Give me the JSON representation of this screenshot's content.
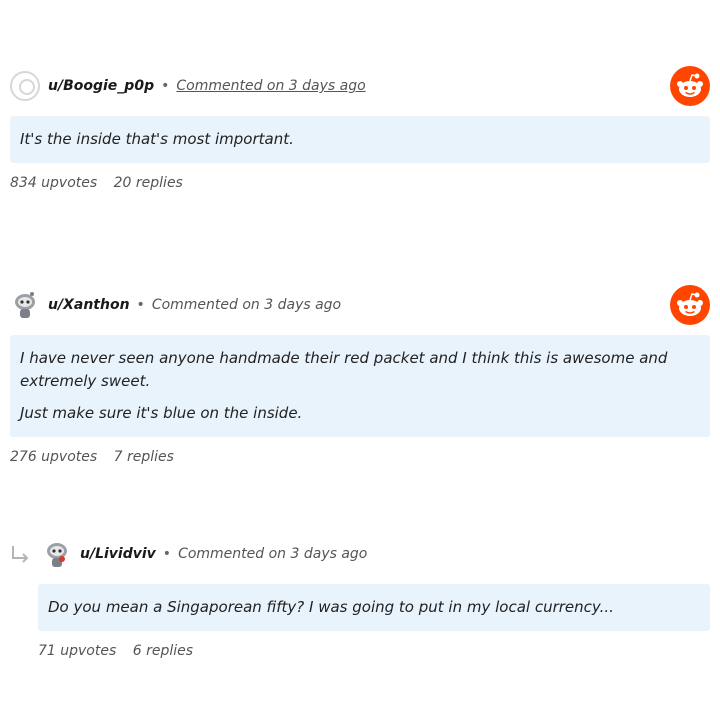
{
  "comments": [
    {
      "author": "u/Boogie_p0p",
      "meta": "Commented on 3 days ago",
      "body": [
        "It's the inside that's most important."
      ],
      "upvotes": "834 upvotes",
      "replies": "20 replies",
      "avatar_icon": "outline-avatar-icon"
    },
    {
      "author": "u/Xanthon",
      "meta": "Commented on 3 days ago",
      "body": [
        "I have never seen anyone handmade their red packet and I think this is awesome and extremely sweet.",
        "Just make sure it's blue on the inside."
      ],
      "upvotes": "276 upvotes",
      "replies": "7 replies",
      "avatar_icon": "snoo-avatar-icon"
    },
    {
      "author": "u/Lividviv",
      "meta": "Commented on 3 days ago",
      "body": [
        "Do you mean a Singaporean fifty? I was going to put in my local currency..."
      ],
      "upvotes": "71 upvotes",
      "replies": "6 replies",
      "avatar_icon": "snoo-avatar-icon",
      "is_reply": true
    }
  ],
  "colors": {
    "reddit_orange": "#ff4500",
    "comment_bg": "#e9f3fb"
  },
  "icons": {
    "brand": "reddit-logo-icon",
    "reply": "reply-arrow-icon"
  }
}
